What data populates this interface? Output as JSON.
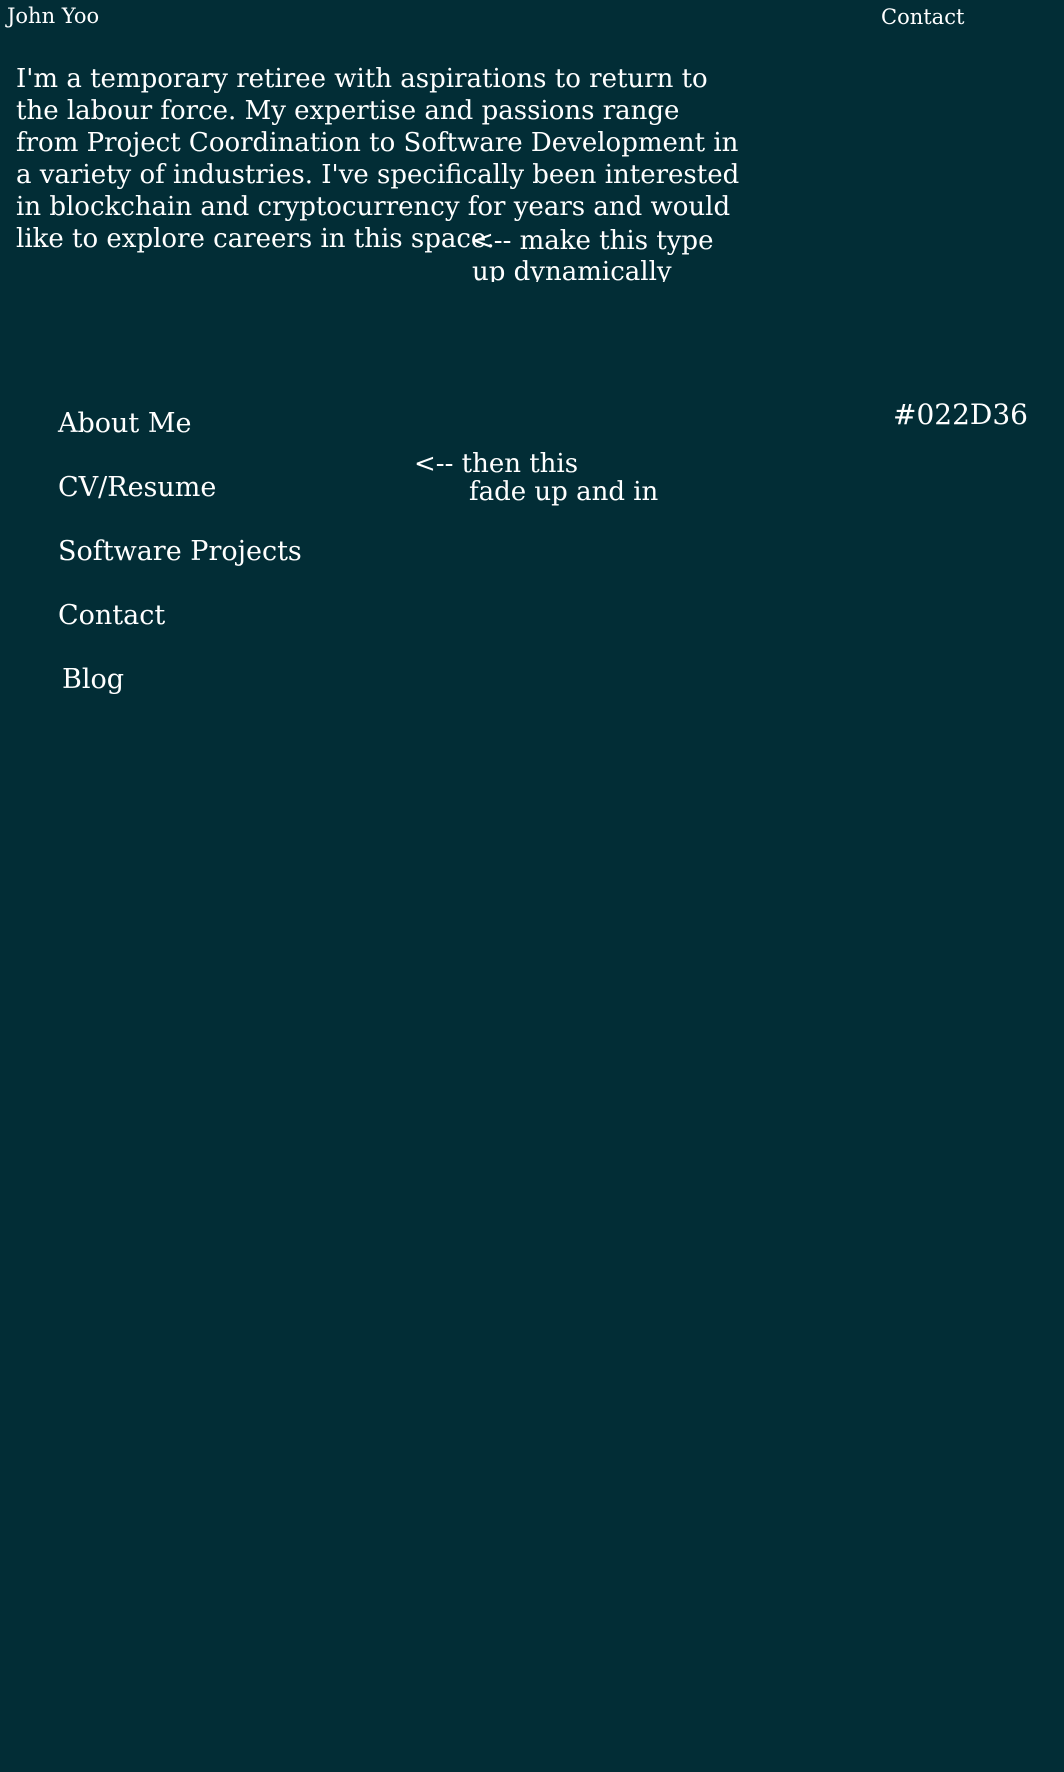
{
  "header": {
    "brand": "John Yoo",
    "contact_label": "Contact"
  },
  "intro": {
    "lines": [
      "I'm a temporary retiree with aspirations to return to",
      "the labour force. My expertise and passions range",
      "from Project Coordination to Software Development in",
      "a variety of industries. I've specifically been interested",
      "in blockchain and cryptocurrency for years and would",
      "like to explore careers in this space."
    ]
  },
  "notes": {
    "type_line1": "<-- make this type",
    "type_line2": "up dynamically",
    "fade_line1": "<-- then this",
    "fade_line2": "fade up and in",
    "color_hex": "#022D36"
  },
  "nav": {
    "items": [
      {
        "label": "About Me"
      },
      {
        "label": "CV/Resume"
      },
      {
        "label": "Software Projects"
      },
      {
        "label": "Contact"
      },
      {
        "label": "Blog"
      }
    ]
  },
  "colors": {
    "background": "#022D36",
    "text": "#ffffff"
  }
}
